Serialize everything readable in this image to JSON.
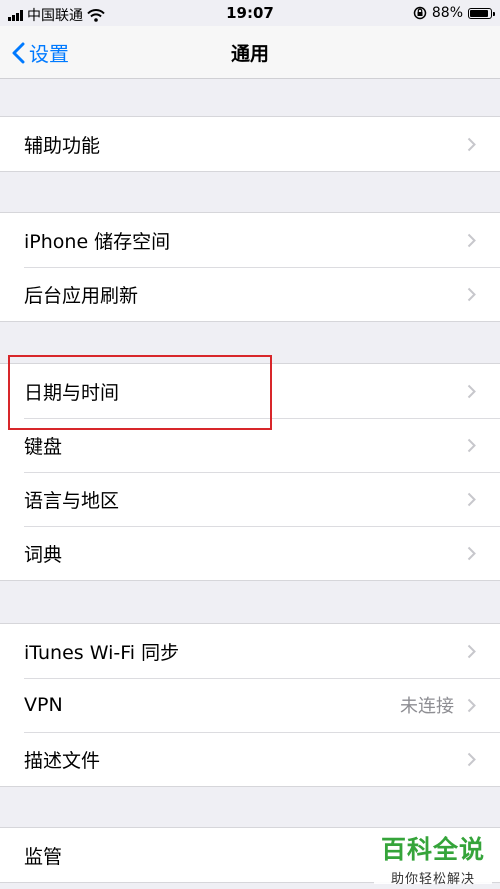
{
  "status_bar": {
    "carrier": "中国联通",
    "time": "19:07",
    "battery": "88%"
  },
  "nav": {
    "back_label": "设置",
    "title": "通用"
  },
  "groups": [
    {
      "items": [
        {
          "label": "辅助功能"
        }
      ]
    },
    {
      "items": [
        {
          "label": "iPhone 储存空间"
        },
        {
          "label": "后台应用刷新"
        }
      ]
    },
    {
      "items": [
        {
          "label": "日期与时间"
        },
        {
          "label": "键盘"
        },
        {
          "label": "语言与地区"
        },
        {
          "label": "词典"
        }
      ]
    },
    {
      "items": [
        {
          "label": "iTunes Wi-Fi 同步"
        },
        {
          "label": "VPN",
          "value": "未连接"
        },
        {
          "label": "描述文件"
        }
      ]
    },
    {
      "items": [
        {
          "label": "监管"
        }
      ]
    }
  ],
  "watermark": {
    "title": "百科全说",
    "subtitle": "助你轻松解决"
  },
  "colors": {
    "accent": "#007aff",
    "highlight": "#d8262a",
    "watermark": "#35a43a"
  }
}
